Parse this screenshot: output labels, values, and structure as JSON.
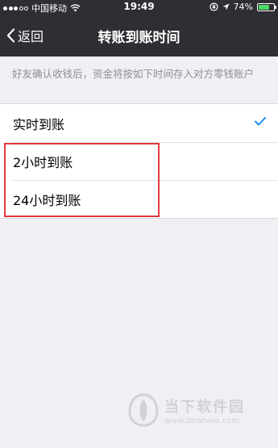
{
  "status_bar": {
    "carrier": "中国移动",
    "time": "19:49",
    "battery": "74%",
    "battery_level": 0.74,
    "icons": [
      "signal-icon",
      "wifi-icon",
      "rotation-lock-icon",
      "location-icon",
      "battery-icon"
    ]
  },
  "nav": {
    "back_label": "返回",
    "title": "转账到账时间"
  },
  "description": "好友确认收钱后，资金将按如下时间存入对方零钱账户",
  "options": [
    {
      "label": "实时到账",
      "selected": true
    },
    {
      "label": "2小时到账",
      "selected": false
    },
    {
      "label": "24小时到账",
      "selected": false
    }
  ],
  "colors": {
    "nav_background": "#2e2e33",
    "page_background": "#efeff4",
    "check": "#1a8cf0",
    "highlight": "#e0393e"
  },
  "watermark": {
    "title": "当下软件园",
    "url": "www.downxia.com"
  }
}
